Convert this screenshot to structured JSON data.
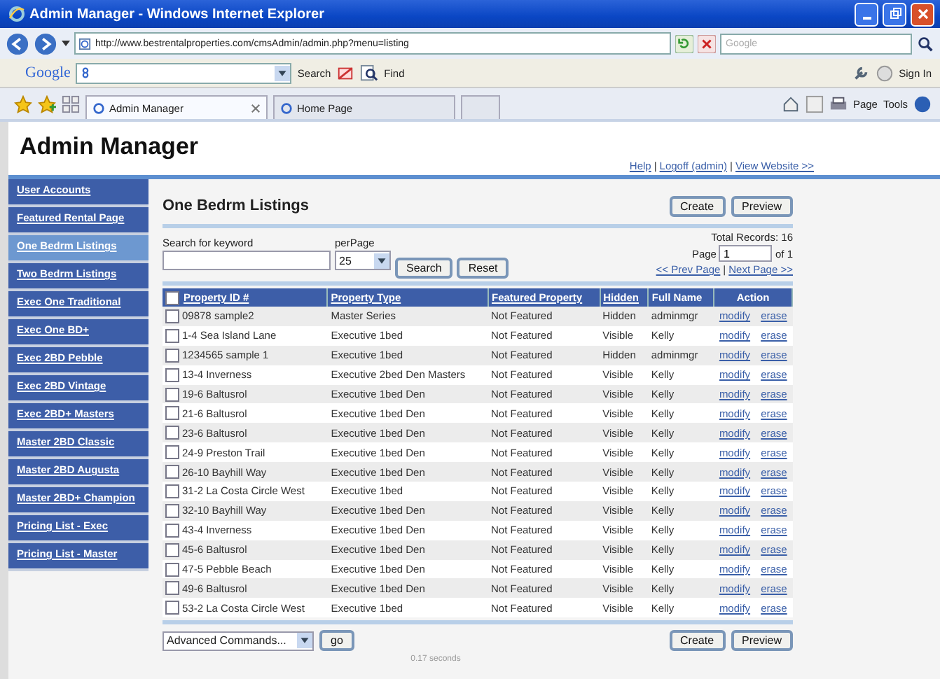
{
  "window": {
    "title": "Admin Manager - Windows Internet Explorer"
  },
  "address_bar": {
    "url": "http://www.bestrentalproperties.com/cmsAdmin/admin.php?menu=listing",
    "search_placeholder": "Google"
  },
  "google_toolbar": {
    "logo": "Google",
    "search_label": "Search",
    "find_label": "Find",
    "sign_in": "Sign In"
  },
  "tabs": [
    {
      "label": "Admin Manager",
      "selected": true
    },
    {
      "label": "Home Page",
      "selected": false
    }
  ],
  "command_bar": [
    "Page",
    "Tools"
  ],
  "page": {
    "title": "Admin Manager",
    "header_links": [
      {
        "kind": "link",
        "text": "Help"
      },
      {
        "kind": "separator",
        "text": "|"
      },
      {
        "kind": "link",
        "text": "Logoff (admin)"
      },
      {
        "kind": "separator",
        "text": "|"
      },
      {
        "kind": "link",
        "text": "View Website >>"
      }
    ],
    "sidebar": [
      {
        "label": "User Accounts",
        "selected": false
      },
      {
        "label": "Featured Rental Page",
        "selected": false
      },
      {
        "label": "One Bedrm Listings",
        "selected": true
      },
      {
        "label": "Two Bedrm Listings",
        "selected": false
      },
      {
        "label": "Exec One Traditional",
        "selected": false
      },
      {
        "label": "Exec One BD+",
        "selected": false
      },
      {
        "label": "Exec 2BD Pebble",
        "selected": false
      },
      {
        "label": "Exec 2BD Vintage",
        "selected": false
      },
      {
        "label": "Exec 2BD+ Masters",
        "selected": false
      },
      {
        "label": "Master 2BD Classic",
        "selected": false
      },
      {
        "label": "Master 2BD Augusta",
        "selected": false
      },
      {
        "label": "Master 2BD+ Champion",
        "selected": false
      },
      {
        "label": "Pricing List - Exec",
        "selected": false
      },
      {
        "label": "Pricing List - Master",
        "selected": false
      }
    ],
    "heading": "One Bedrm Listings",
    "top_buttons": [
      "Create",
      "Preview"
    ],
    "search_label": "Search for keyword",
    "perpage_label": "perPage",
    "perpage_value": "25",
    "search_buttons": [
      "Search",
      "Reset"
    ],
    "total_records": "Total Records: 16",
    "page_label": "Page",
    "page_value": "1",
    "page_of": "of 1",
    "pager_links": [
      {
        "kind": "link",
        "text": "<< Prev Page"
      },
      {
        "kind": "separator",
        "text": "|"
      },
      {
        "kind": "link",
        "text": "Next Page >>"
      }
    ],
    "table": {
      "select_all_checked": false,
      "columns": [
        {
          "label": "Property ID #",
          "link": true
        },
        {
          "label": "Property Type",
          "link": true
        },
        {
          "label": "Featured Property",
          "link": true
        },
        {
          "label": "Hidden",
          "link": true
        },
        {
          "label": "Full Name",
          "link": false
        },
        {
          "label": "Action",
          "link": false
        }
      ],
      "rows": [
        {
          "checked": false,
          "id": "09878 sample2",
          "type": "Master Series",
          "featured": "Not Featured",
          "hidden": "Hidden",
          "name": "adminmgr",
          "actions": [
            "modify",
            "erase"
          ]
        },
        {
          "checked": false,
          "id": "1-4 Sea Island Lane",
          "type": "Executive 1bed",
          "featured": "Not Featured",
          "hidden": "Visible",
          "name": "Kelly",
          "actions": [
            "modify",
            "erase"
          ]
        },
        {
          "checked": false,
          "id": "1234565 sample 1",
          "type": "Executive 1bed",
          "featured": "Not Featured",
          "hidden": "Hidden",
          "name": "adminmgr",
          "actions": [
            "modify",
            "erase"
          ]
        },
        {
          "checked": false,
          "id": "13-4 Inverness",
          "type": "Executive 2bed Den Masters",
          "featured": "Not Featured",
          "hidden": "Visible",
          "name": "Kelly",
          "actions": [
            "modify",
            "erase"
          ]
        },
        {
          "checked": false,
          "id": "19-6 Baltusrol",
          "type": "Executive 1bed Den",
          "featured": "Not Featured",
          "hidden": "Visible",
          "name": "Kelly",
          "actions": [
            "modify",
            "erase"
          ]
        },
        {
          "checked": false,
          "id": "21-6 Baltusrol",
          "type": "Executive 1bed Den",
          "featured": "Not Featured",
          "hidden": "Visible",
          "name": "Kelly",
          "actions": [
            "modify",
            "erase"
          ]
        },
        {
          "checked": false,
          "id": "23-6 Baltusrol",
          "type": "Executive 1bed Den",
          "featured": "Not Featured",
          "hidden": "Visible",
          "name": "Kelly",
          "actions": [
            "modify",
            "erase"
          ]
        },
        {
          "checked": false,
          "id": "24-9 Preston Trail",
          "type": "Executive 1bed Den",
          "featured": "Not Featured",
          "hidden": "Visible",
          "name": "Kelly",
          "actions": [
            "modify",
            "erase"
          ]
        },
        {
          "checked": false,
          "id": "26-10 Bayhill Way",
          "type": "Executive 1bed Den",
          "featured": "Not Featured",
          "hidden": "Visible",
          "name": "Kelly",
          "actions": [
            "modify",
            "erase"
          ]
        },
        {
          "checked": false,
          "id": "31-2 La Costa Circle West",
          "type": "Executive 1bed",
          "featured": "Not Featured",
          "hidden": "Visible",
          "name": "Kelly",
          "actions": [
            "modify",
            "erase"
          ]
        },
        {
          "checked": false,
          "id": "32-10 Bayhill Way",
          "type": "Executive 1bed Den",
          "featured": "Not Featured",
          "hidden": "Visible",
          "name": "Kelly",
          "actions": [
            "modify",
            "erase"
          ]
        },
        {
          "checked": false,
          "id": "43-4 Inverness",
          "type": "Executive 1bed Den",
          "featured": "Not Featured",
          "hidden": "Visible",
          "name": "Kelly",
          "actions": [
            "modify",
            "erase"
          ]
        },
        {
          "checked": false,
          "id": "45-6 Baltusrol",
          "type": "Executive 1bed Den",
          "featured": "Not Featured",
          "hidden": "Visible",
          "name": "Kelly",
          "actions": [
            "modify",
            "erase"
          ]
        },
        {
          "checked": false,
          "id": "47-5 Pebble Beach",
          "type": "Executive 1bed Den",
          "featured": "Not Featured",
          "hidden": "Visible",
          "name": "Kelly",
          "actions": [
            "modify",
            "erase"
          ]
        },
        {
          "checked": false,
          "id": "49-6 Baltusrol",
          "type": "Executive 1bed Den",
          "featured": "Not Featured",
          "hidden": "Visible",
          "name": "Kelly",
          "actions": [
            "modify",
            "erase"
          ]
        },
        {
          "checked": false,
          "id": "53-2 La Costa Circle West",
          "type": "Executive 1bed",
          "featured": "Not Featured",
          "hidden": "Visible",
          "name": "Kelly",
          "actions": [
            "modify",
            "erase"
          ]
        }
      ]
    },
    "advanced_select": "Advanced Commands...",
    "go_button": "go",
    "bottom_buttons": [
      "Create",
      "Preview"
    ],
    "timing": "0.17 seconds"
  }
}
